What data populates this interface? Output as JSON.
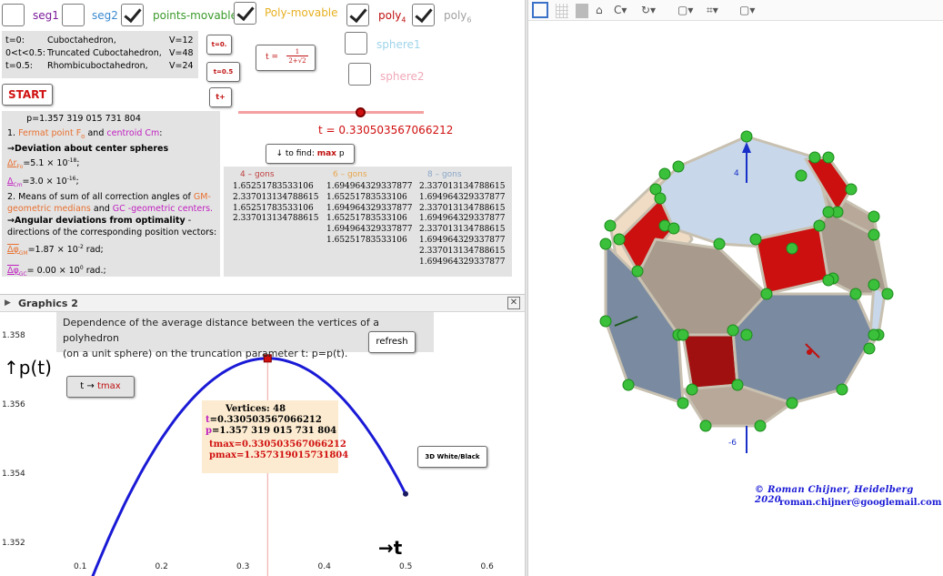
{
  "controls": {
    "seg1": {
      "label": "seg1",
      "checked": false
    },
    "seg2": {
      "label": "seg2",
      "checked": false
    },
    "points_movable": {
      "label": "points-movable",
      "checked": true
    },
    "poly_movable": {
      "label": "Poly-movable",
      "checked": true
    },
    "poly4": {
      "label": "poly",
      "sub": "4",
      "checked": true
    },
    "poly6": {
      "label": "poly",
      "sub": "6",
      "checked": true
    },
    "sphere1": {
      "label": "sphere1",
      "checked": false
    },
    "sphere2": {
      "label": "sphere2",
      "checked": false
    }
  },
  "info_box": {
    "rows": [
      {
        "t": "t=0:",
        "name": "Cuboctahedron,",
        "v": "V=12"
      },
      {
        "t": "0<t<0.5:",
        "name": "Truncated Cuboctahedron,",
        "v": "V=48"
      },
      {
        "t": "t=0.5:",
        "name": "Rhombicuboctahedron,",
        "v": "V=24"
      }
    ]
  },
  "buttons": {
    "start": "START",
    "t0": "t=0.",
    "t05": "t=0.5",
    "tplus": "t+",
    "t_formula_prefix": "t =",
    "t_formula_num": "1",
    "t_formula_den": "2+√2",
    "find_max_prefix": "↓ to find: ",
    "find_max_key": "max",
    "find_max_suffix": " p",
    "refresh": "refresh",
    "t_to_tmax_prefix": "t → ",
    "t_to_tmax_key": "tmax",
    "white_black": "3D White/Black"
  },
  "slider": {
    "value_text": "t = 0.330503567066212",
    "fraction": 0.66
  },
  "results": {
    "p_line": "p=1.357 319 015 731 804",
    "item1_prefix": "1. ",
    "fermat": "Fermat point  F",
    "fermat_sub": "o",
    "and": " and ",
    "centroid": "centroid Cm",
    "colon": ":",
    "deviation_title": "→Deviation about center spheres",
    "dev_fermat": "Δr",
    "dev_fermat_val": "=5.1 × 10",
    "dev_fermat_exp": "-18",
    "dev_cm": "Δ",
    "dev_cm_val": "=3.0 × 10",
    "dev_cm_exp": "-16",
    "item2_a": "2. Means of sum of all correction angles of ",
    "gm_word": "GM-",
    "gm_word2": "geometric medians",
    "item2_and": " and ",
    "gc_word": "GC -geometric centers.",
    "angular_title": "→Angular deviations from optimality",
    "angular_tail": " -",
    "angular_desc": "directions of the corresponding position vectors:",
    "dphi_gm": "Δφ",
    "dphi_gm_sub": "GM",
    "dphi_gm_val": "=1.87 × 10",
    "dphi_gm_exp": "-2",
    "dphi_gm_unit": "  rad;",
    "dphi_gc": "Δφ",
    "dphi_gc_sub": "GC",
    "dphi_gc_val": "= 0.00 × 10",
    "dphi_gc_exp": "0",
    "dphi_gc_unit": " rad.;"
  },
  "gons_table": {
    "headers": [
      "4 – gons",
      "6 – gons",
      "8 – gons"
    ],
    "header_colors": [
      "#c04040",
      "#e8a64a",
      "#8aa6c8"
    ],
    "col4": [
      "1.65251783533106",
      "2.337013134788615",
      "1.65251783533106",
      "2.337013134788615"
    ],
    "col6": [
      "1.694964329337877",
      "1.65251783533106",
      "1.694964329337877",
      "1.65251783533106",
      "1.694964329337877",
      "1.65251783533106"
    ],
    "col8": [
      "2.337013134788615",
      "1.694964329337877",
      "2.337013134788615",
      "1.694964329337877",
      "2.337013134788615",
      "1.694964329337877",
      "2.337013134788615",
      "1.694964329337877"
    ]
  },
  "graphics2": {
    "title": "Graphics 2",
    "close": "✕",
    "description_line1": "Dependence of the average distance between the vertices of a polyhedron",
    "description_line2": "(on a unit sphere) on the truncation parameter t: p=p(t).",
    "y_axis_label": "↑p(t)",
    "x_axis_label": "→t",
    "y_ticks": [
      "1.358",
      "1.356",
      "1.354",
      "1.352"
    ],
    "x_ticks": [
      "0.1",
      "0.2",
      "0.3",
      "0.4",
      "0.5",
      "0.6"
    ],
    "tooltip": {
      "vertices": "Vertices: 48",
      "t_line": "t=0.330503567066212",
      "p_line": "p=1.357 319 015 731 804",
      "tmax_line": "tmax=0.330503567066212",
      "pmax_line": "pmax=1.357319015731804"
    }
  },
  "chart_data": {
    "type": "line",
    "x": [
      0.1,
      0.15,
      0.2,
      0.25,
      0.3,
      0.3305,
      0.35,
      0.4,
      0.45,
      0.5
    ],
    "y": [
      1.3508,
      1.3537,
      1.3558,
      1.357,
      1.35755,
      1.35732,
      1.3572,
      1.3566,
      1.3556,
      1.3534
    ],
    "xlim": [
      0.05,
      0.65
    ],
    "ylim": [
      1.3505,
      1.3585
    ],
    "series_color": "#1a1ad6",
    "marker": {
      "x": 0.3305,
      "y": 1.35732
    }
  },
  "view3d": {
    "axis_label_top": "4",
    "axis_label_bottom": "-6",
    "copyright_line1": "©   Roman  Chijner,  Heidelberg  2020",
    "copyright_line2": "roman.chijner@googlemail.com"
  },
  "toolbar": {
    "icons": [
      "graphics-view-icon",
      "grid-icon",
      "shade-icon",
      "home-icon",
      "rotate-icon",
      "animate-icon",
      "view-cube-icon",
      "point-capture-icon",
      "projection-icon"
    ]
  }
}
